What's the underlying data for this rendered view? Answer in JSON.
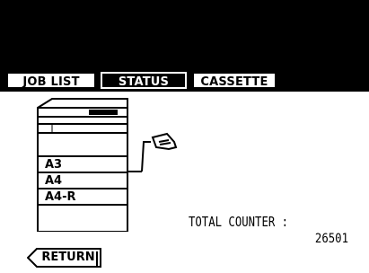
{
  "tabs": [
    {
      "label": "JOB LIST",
      "active": false
    },
    {
      "label": "STATUS",
      "active": true
    },
    {
      "label": "CASSETTE",
      "active": false
    }
  ],
  "trays": [
    {
      "label": "A3"
    },
    {
      "label": "A4"
    },
    {
      "label": "A4-R"
    }
  ],
  "counter": {
    "label": "TOTAL COUNTER :",
    "value": "26501"
  },
  "return_label": "RETURN"
}
